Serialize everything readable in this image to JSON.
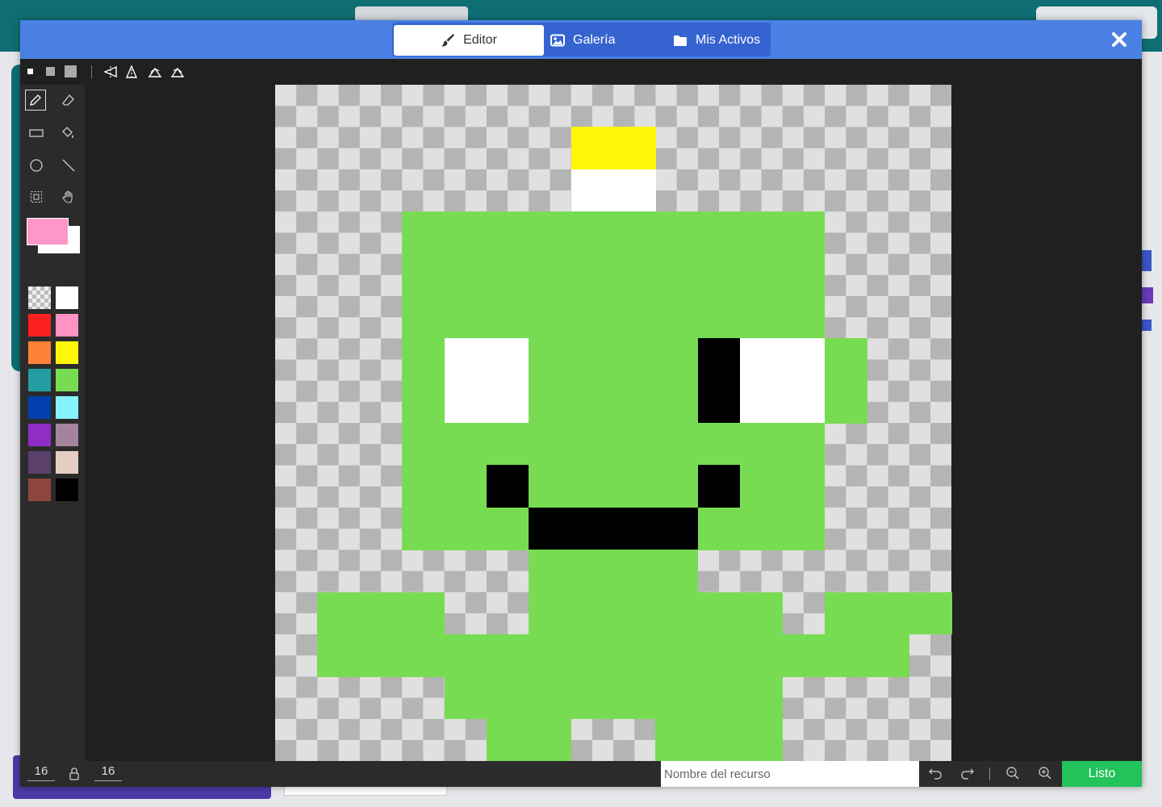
{
  "tabs": [
    {
      "label": "Editor",
      "icon": "paintbrush-icon",
      "active": true
    },
    {
      "label": "Galería",
      "icon": "image-icon",
      "active": false
    },
    {
      "label": "Mis Activos",
      "icon": "folder-icon",
      "active": false
    }
  ],
  "close_icon": "close-icon",
  "toolbar": {
    "brush_sizes": [
      "small",
      "medium",
      "large"
    ],
    "transforms": [
      "flip-horizontal-icon",
      "flip-vertical-icon",
      "rotate-clockwise-icon",
      "rotate-counterclockwise-icon"
    ]
  },
  "tools": [
    "pencil-icon",
    "eraser-icon",
    "rectangle-icon",
    "fill-bucket-icon",
    "circle-icon",
    "line-icon",
    "marquee-icon",
    "pan-hand-icon"
  ],
  "colors": {
    "primary": "#ff96c8",
    "secondary": "#ffffff",
    "palette": [
      "transparent",
      "#ffffff",
      "#ff2121",
      "#ff93c4",
      "#ff8135",
      "#fff609",
      "#249ca3",
      "#78dc52",
      "#003fad",
      "#87f2ff",
      "#8e2ec4",
      "#a4839f",
      "#5c406c",
      "#e5cdc4",
      "#91463d",
      "#000000"
    ]
  },
  "sprite": {
    "grid_size": 16,
    "background": "transparent",
    "pixels": [
      "................",
      ".......55.......",
      ".......11.......",
      "...7777777777...",
      "...7777777777...",
      "...7777777777...",
      "...7117777f117..",
      "...7117777f117..",
      "...7777777777...",
      "...77f7777f77...",
      "...777ffff777...",
      "......7777......",
      ".777..777777.777",
      ".77777777777777.",
      "....77777777....",
      ".....77..777...."
    ],
    "pixel_colors": {
      "1": "#ffffff",
      "5": "#fff609",
      "7": "#78dc52",
      "f": "#000000"
    }
  },
  "bottom": {
    "width_value": "16",
    "height_value": "16",
    "asset_name_placeholder": "Nombre del recurso",
    "done_label": "Listo"
  }
}
